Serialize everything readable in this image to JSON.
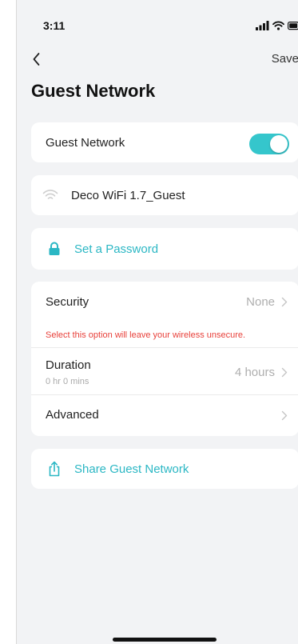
{
  "status_bar": {
    "time": "3:11"
  },
  "nav": {
    "save_label": "Save"
  },
  "page": {
    "title": "Guest Network"
  },
  "guest_toggle": {
    "label": "Guest Network",
    "enabled": true
  },
  "ssid": {
    "name": "Deco WiFi 1.7_Guest"
  },
  "password": {
    "label": "Set a Password"
  },
  "settings": {
    "security": {
      "label": "Security",
      "value": "None"
    },
    "warning": "Select this option will leave your wireless unsecure.",
    "duration": {
      "label": "Duration",
      "sublabel": "0 hr 0 mins",
      "value": "4 hours"
    },
    "advanced": {
      "label": "Advanced"
    }
  },
  "share": {
    "label": "Share Guest Network"
  },
  "colors": {
    "accent": "#35c6cc",
    "link": "#2bb7c4",
    "warning": "#e8403a",
    "background": "#f2f3f5"
  }
}
